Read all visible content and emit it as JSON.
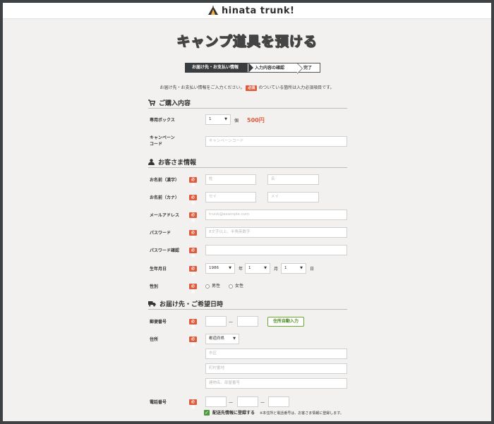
{
  "header": {
    "logo_text": "hinata trunk!"
  },
  "page_title": "キャンプ道具を預ける",
  "steps": [
    "お届け先・お支払い情報",
    "入力内容の確認",
    "完了"
  ],
  "notice": {
    "before": "お届け先・お支払い情報をご入力ください。",
    "badge": "必須",
    "after": "のついている箇所は入力必須項目です。"
  },
  "required_badge": "必須",
  "section_purchase": {
    "title": "ご購入内容",
    "box_label": "専用ボックス",
    "box_qty": "1",
    "box_unit": "個",
    "box_price": "500円",
    "campaign_label_1": "キャンペーン",
    "campaign_label_2": "コード",
    "campaign_placeholder": "キャンペーンコード"
  },
  "section_customer": {
    "title": "お客さま情報",
    "name_label": "お名前（漢字）",
    "name_last_ph": "姓",
    "name_first_ph": "名",
    "kana_label": "お名前（カナ）",
    "kana_last_ph": "セイ",
    "kana_first_ph": "メイ",
    "email_label": "メールアドレス",
    "email_ph": "trunk@example.com",
    "password_label": "パスワード",
    "password_ph": "8文字以上、半角英数字",
    "password_confirm_label": "パスワード確認",
    "birthday_label": "生年月日",
    "birth_year": "1986",
    "year_unit": "年",
    "birth_month": "1",
    "month_unit": "月",
    "birth_day": "1",
    "day_unit": "日",
    "gender_label": "性別",
    "gender_male": "男性",
    "gender_female": "女性"
  },
  "section_delivery": {
    "title": "お届け先・ご希望日時",
    "zip_label": "郵便番号",
    "zip_dash": "—",
    "address_button": "住所自動入力",
    "address_label": "住所",
    "prefecture": "都道府県",
    "city_ph": "市区",
    "street_ph": "町村番地",
    "building_ph": "建物名、部屋番号",
    "phone_label": "電話番号",
    "phone_dash": "—",
    "register_label": "配送先情報に登録する",
    "register_note": "※本住所と電話番号は、お客さま情報に登録します。"
  }
}
